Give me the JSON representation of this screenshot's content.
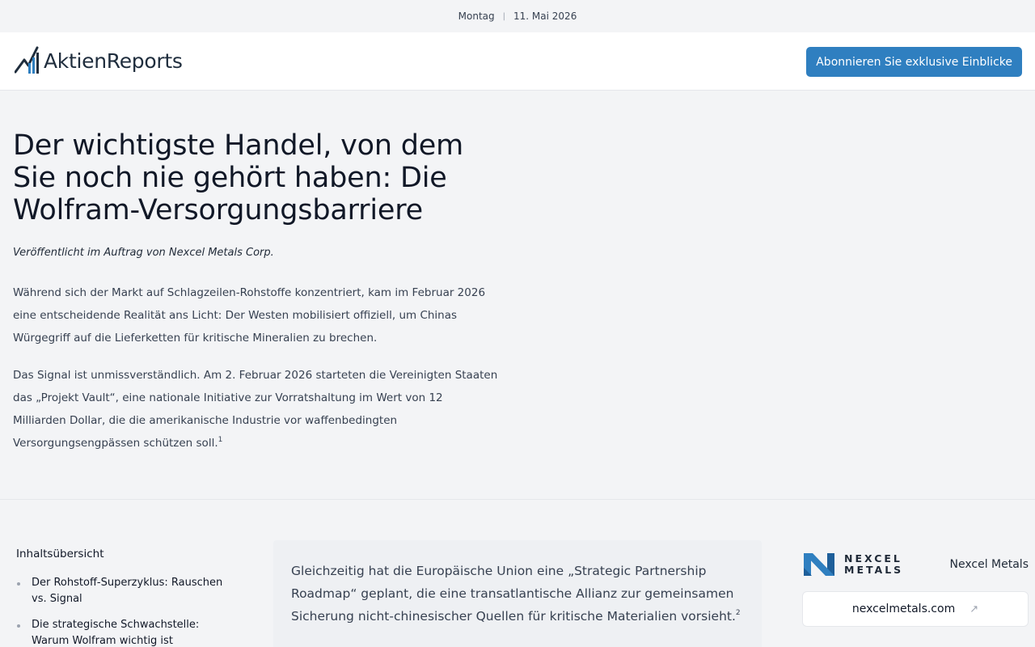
{
  "datebar": {
    "weekday": "Montag",
    "separator": "|",
    "date": "11. Mai 2026"
  },
  "header": {
    "logo_text": "AktienReports",
    "logo_icon": "bar-chart-trend-icon",
    "subscribe_label": "Abonnieren Sie exklusive Einblicke"
  },
  "article": {
    "title": "Der wichtigste Handel, von dem Sie noch nie gehört haben: Die Wolfram-Versorgungsbarriere",
    "byline": "Veröffentlicht im Auftrag von Nexcel Metals Corp.",
    "paragraph1": "Während sich der Markt auf Schlagzeilen-Rohstoffe konzentriert, kam im Februar 2026 eine entscheidende Realität ans Licht: Der Westen mobilisiert offiziell, um Chinas Würgegriff auf die Lieferketten für kritische Mineralien zu brechen.",
    "paragraph2": "Das Signal ist unmissverständlich. Am 2. Februar 2026 starteten die Vereinigten Staaten das „Projekt Vault“, eine nationale Initiative zur Vorratshaltung im Wert von 12 Milliarden Dollar, die die amerikanische Industrie vor waffenbedingten Versorgungsengpässen schützen soll.",
    "paragraph2_footnote": "1"
  },
  "toc": {
    "title": "Inhaltsübersicht",
    "items": [
      {
        "label": "Der Rohstoff-Superzyklus: Rauschen vs. Signal"
      },
      {
        "label": "Die strategische Schwachstelle: Warum Wolfram wichtig ist"
      }
    ]
  },
  "callout": {
    "text": "Gleichzeitig hat die Europäische Union eine „Strategic Partnership Roadmap“ geplant, die eine transatlantische Allianz zur gemeinsamen Sicherung nicht-chinesischer Quellen für kritische Materialien vorsieht.",
    "footnote": "2"
  },
  "sponsor": {
    "logo_line1": "NEXCEL",
    "logo_line2": "METALS",
    "name": "Nexcel Metals",
    "website": "nexcelmetals.com",
    "external_icon": "↗",
    "brand_color": "#2f7fc0"
  },
  "colors": {
    "accent": "#2f7fc0",
    "title": "#111827",
    "body": "#374151"
  }
}
